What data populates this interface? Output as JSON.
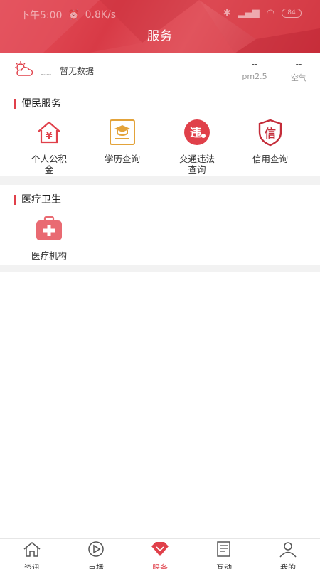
{
  "status_bar": {
    "time": "下午5:00",
    "speed": "0.8K/s",
    "battery": "84"
  },
  "header": {
    "title": "服务"
  },
  "weather": {
    "temperature": "--",
    "wave": "~~",
    "status_text": "暂无数据",
    "metrics": [
      {
        "value": "--",
        "label": "pm2.5"
      },
      {
        "value": "--",
        "label": "空气"
      }
    ]
  },
  "sections": [
    {
      "title": "便民服务",
      "items": [
        {
          "label": "个人公积金",
          "icon": "housing-fund-icon"
        },
        {
          "label": "学历查询",
          "icon": "education-certificate-icon"
        },
        {
          "label": "交通违法查询",
          "icon": "traffic-violation-icon"
        },
        {
          "label": "信用查询",
          "icon": "credit-shield-icon"
        }
      ]
    },
    {
      "title": "医疗卫生",
      "items": [
        {
          "label": "医疗机构",
          "icon": "medical-kit-icon"
        }
      ]
    }
  ],
  "tabbar": {
    "active": 2,
    "items": [
      {
        "label": "资讯",
        "icon": "home-icon"
      },
      {
        "label": "点播",
        "icon": "play-icon"
      },
      {
        "label": "服务",
        "icon": "service-diamond-icon"
      },
      {
        "label": "互动",
        "icon": "news-icon"
      },
      {
        "label": "我的",
        "icon": "user-icon"
      }
    ]
  },
  "colors": {
    "accent": "#e0404a",
    "header_red": "#d83a46",
    "gold": "#e3a33a"
  }
}
